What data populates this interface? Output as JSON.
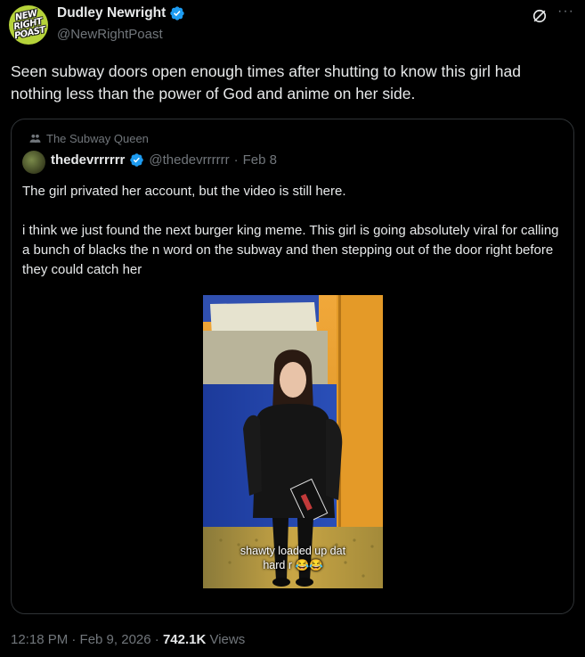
{
  "author": {
    "name": "Dudley Newright",
    "handle": "@NewRightPoast",
    "avatar_text": [
      "NEW",
      "RIGHT",
      "POAST"
    ]
  },
  "post": {
    "text": "Seen subway doors open enough times after shutting to know this girl had nothing less than the power of God and anime on her side."
  },
  "quote": {
    "social_context": "The Subway Queen",
    "name": "thedevrrrrrr",
    "handle": "@thedevrrrrrr",
    "date": "Feb 8",
    "paragraph1": "The girl privated her account, but the video is still here.",
    "paragraph2": "i think we just found the next burger king meme. This girl is going absolutely viral for calling a bunch of blacks the n word on the subway and then stepping out of the door right before they could catch her",
    "video_caption_line1": "shawty loaded up dat",
    "video_caption_line2": "hard r 😂😂"
  },
  "footer": {
    "time_date": "12:18 PM · Feb 9, 2026 · ",
    "views_count": "742.1K",
    "views_label": " Views"
  },
  "colors": {
    "background": "#000000",
    "text_primary": "#e7e9ea",
    "text_secondary": "#71767b",
    "verified_blue": "#1d9bf0",
    "border": "#2f3336",
    "avatar_green": "#b6d33a"
  },
  "icons": [
    "verified-badge-icon",
    "grok-icon",
    "more-icon",
    "community-icon"
  ]
}
